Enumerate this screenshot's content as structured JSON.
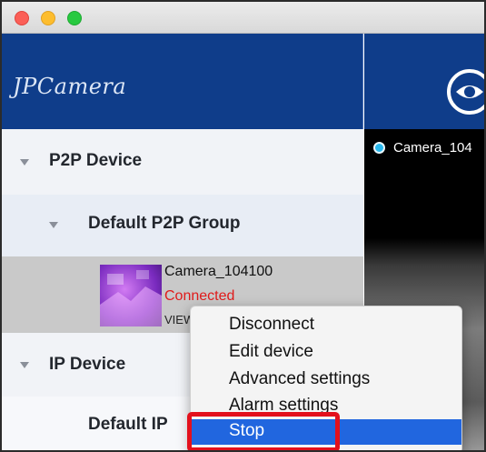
{
  "app": {
    "logo_text": "JPCamera"
  },
  "tree": {
    "p2p_device": "P2P Device",
    "default_p2p_group": "Default P2P Group",
    "camera": {
      "name": "Camera_104100",
      "status": "Connected",
      "view_label": "VIEW"
    },
    "ip_device": "IP Device",
    "default_ip_group": "Default IP"
  },
  "video": {
    "camera_label": "Camera_104"
  },
  "context_menu": {
    "items": [
      "Disconnect",
      "Edit device",
      "Advanced settings",
      "Alarm settings",
      "Stop"
    ],
    "selected": "Stop"
  },
  "colors": {
    "header_bg": "#0f3d8a",
    "status_connected": "#e01b1b",
    "menu_selected": "#2166df",
    "annotation_highlight": "#e3101c"
  },
  "icons": {
    "eye": "eye-icon",
    "close": "close-window-icon",
    "minimize": "minimize-window-icon",
    "zoom": "zoom-window-icon",
    "disclosure": "disclosure-triangle-icon"
  }
}
